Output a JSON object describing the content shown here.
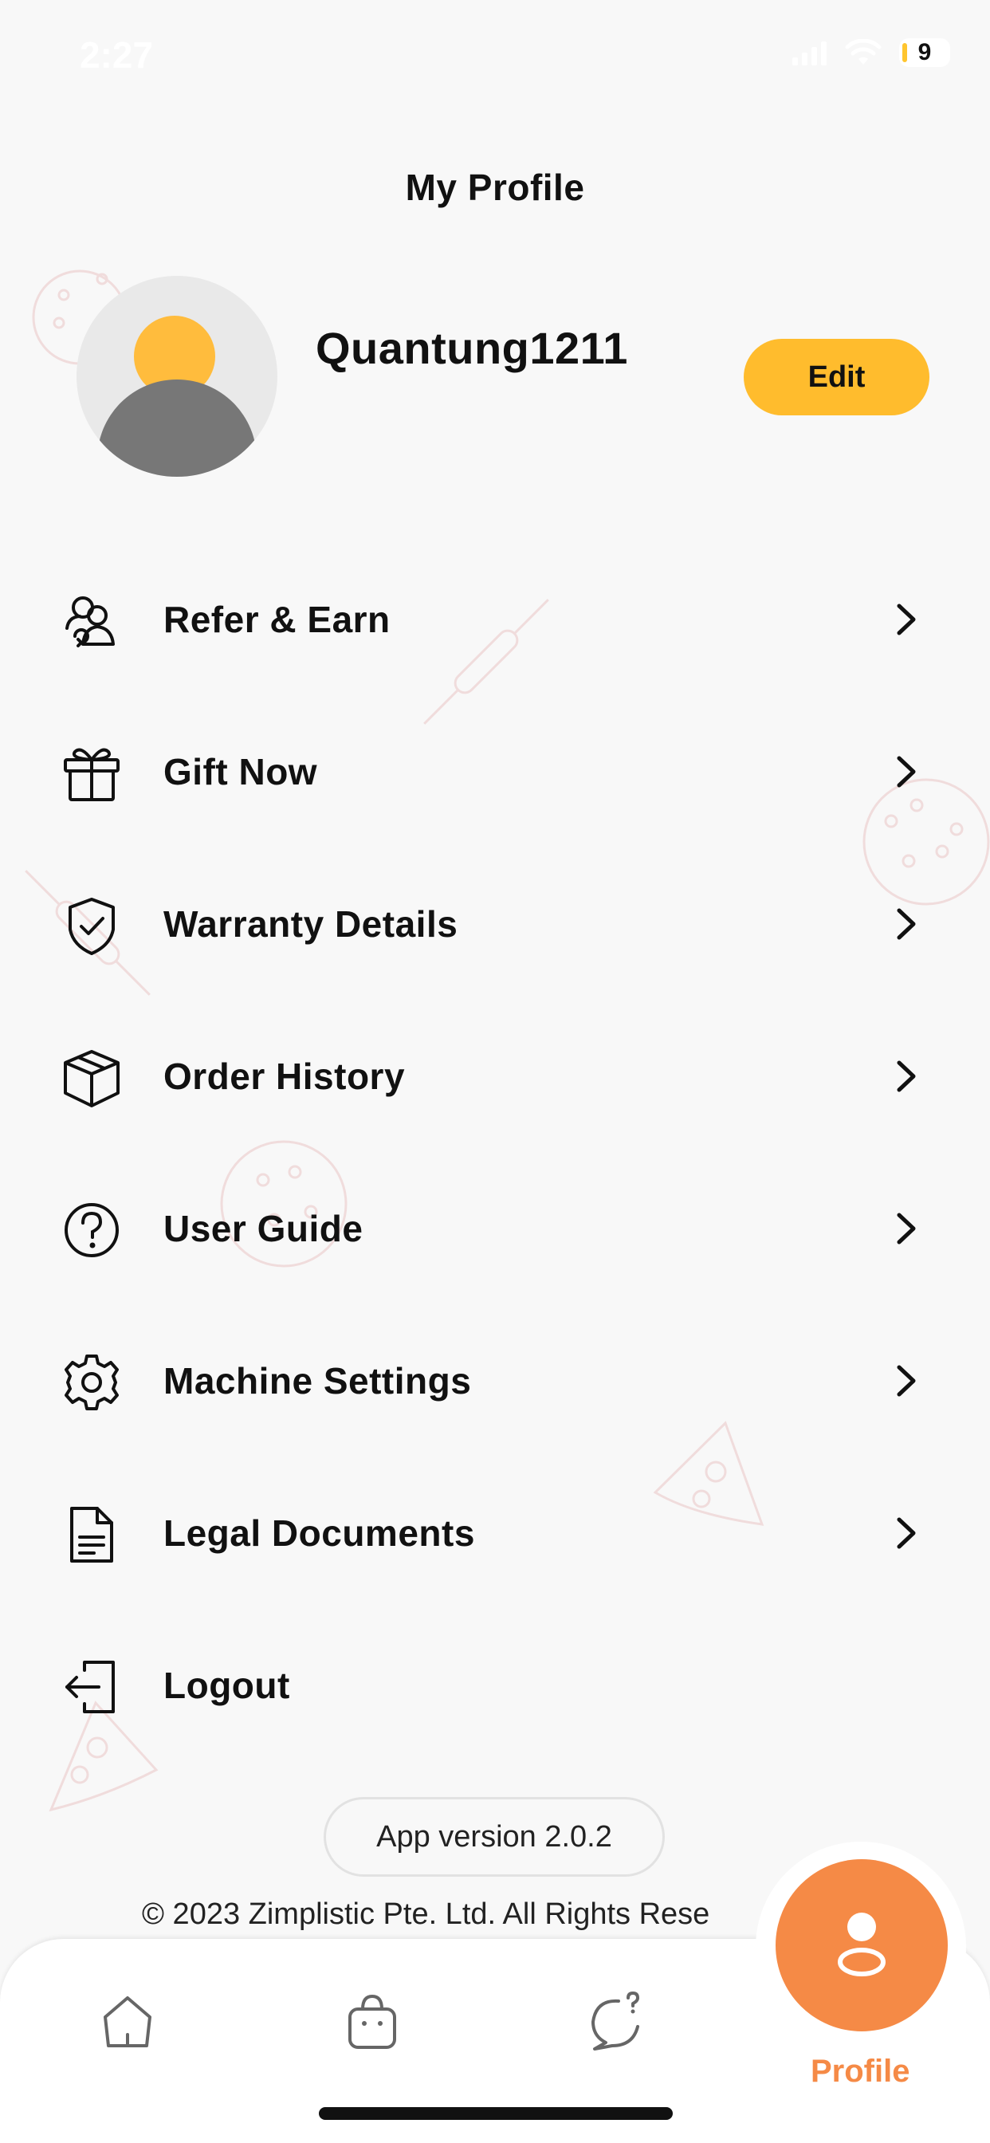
{
  "status_bar": {
    "time": "2:27",
    "battery": "9"
  },
  "header": {
    "title": "My Profile"
  },
  "profile": {
    "username": "Quantung1211",
    "edit_label": "Edit"
  },
  "menu": [
    {
      "label": "Refer & Earn",
      "icon": "refer-icon"
    },
    {
      "label": "Gift Now",
      "icon": "gift-icon"
    },
    {
      "label": "Warranty Details",
      "icon": "shield-check-icon"
    },
    {
      "label": "Order History",
      "icon": "box-icon"
    },
    {
      "label": "User Guide",
      "icon": "question-circle-icon"
    },
    {
      "label": "Machine Settings",
      "icon": "gear-icon"
    },
    {
      "label": "Legal Documents",
      "icon": "document-icon"
    },
    {
      "label": "Logout",
      "icon": "logout-icon"
    }
  ],
  "footer": {
    "version": "App version 2.0.2",
    "copyright": "© 2023 Zimplistic Pte. Ltd. All Rights Rese"
  },
  "bottom_nav": {
    "items": [
      "home-icon",
      "bag-icon",
      "chat-question-icon",
      "profile-icon"
    ],
    "active_label": "Profile"
  },
  "colors": {
    "accent": "#ffbc2d",
    "active": "#f58a46",
    "background": "#f8f8f8"
  }
}
